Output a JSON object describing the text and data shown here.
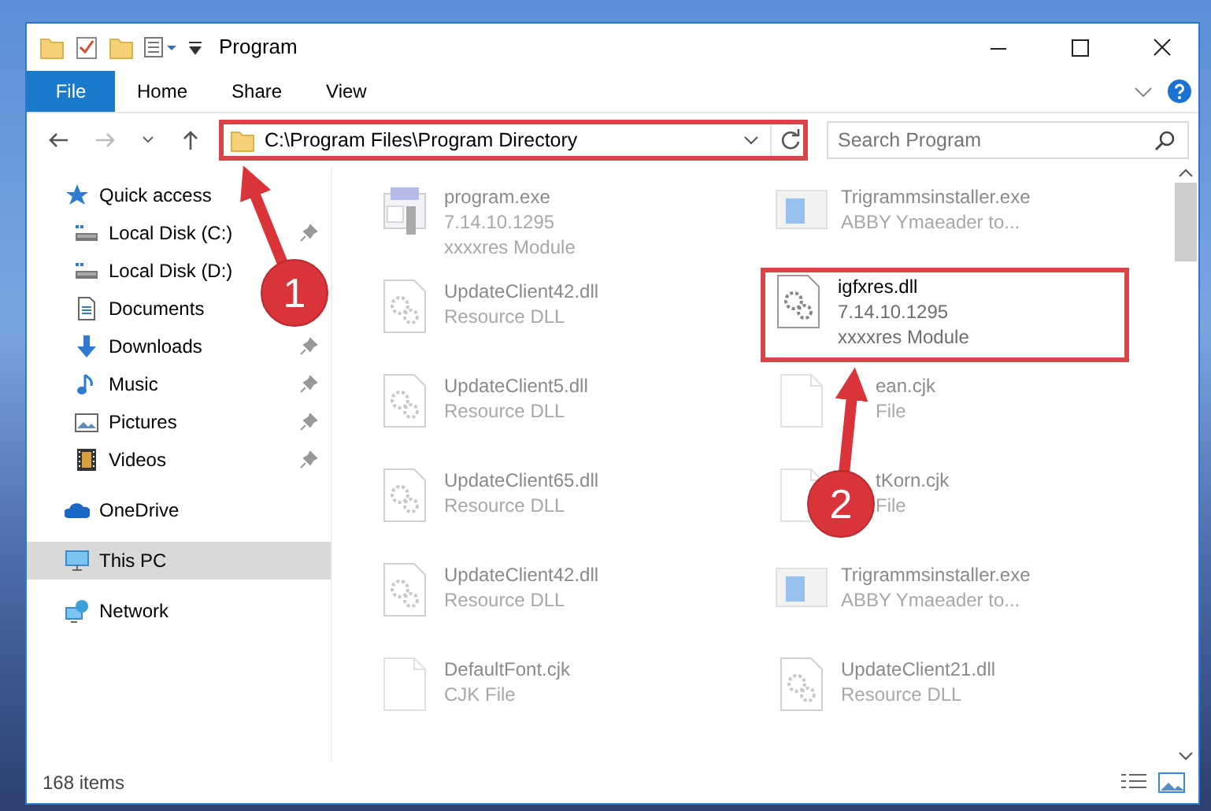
{
  "window": {
    "title": "Program"
  },
  "ribbon_tabs": [
    {
      "label": "File",
      "kind": "file"
    },
    {
      "label": "Home",
      "kind": "tab"
    },
    {
      "label": "Share",
      "kind": "tab"
    },
    {
      "label": "View",
      "kind": "tab"
    }
  ],
  "address": {
    "path": "C:\\Program Files\\Program Directory",
    "highlighted": true
  },
  "search": {
    "placeholder": "Search Program"
  },
  "nav": [
    {
      "label": "Quick access",
      "kind": "star",
      "selected": false,
      "children": [
        {
          "label": "Local Disk (C:)",
          "kind": "drive",
          "pinned": true,
          "selected": false
        },
        {
          "label": "Local Disk (D:)",
          "kind": "drive",
          "pinned": false,
          "selected": false
        },
        {
          "label": "Documents",
          "kind": "doc",
          "pinned": false,
          "selected": false
        },
        {
          "label": "Downloads",
          "kind": "download",
          "pinned": true,
          "selected": false
        },
        {
          "label": "Music",
          "kind": "music",
          "pinned": true,
          "selected": false
        },
        {
          "label": "Pictures",
          "kind": "picture",
          "pinned": true,
          "selected": false
        },
        {
          "label": "Videos",
          "kind": "video",
          "pinned": true,
          "selected": false
        }
      ]
    },
    {
      "label": "OneDrive",
      "kind": "cloud",
      "selected": false
    },
    {
      "label": "This PC",
      "kind": "pc",
      "selected": true
    },
    {
      "label": "Network",
      "kind": "network",
      "selected": false
    }
  ],
  "files": [
    {
      "name": "program.exe",
      "details": [
        "7.14.10.1295",
        "xxxxres Module"
      ],
      "kind": "exe",
      "highlighted": false
    },
    {
      "name": "Trigrammsinstaller.exe",
      "details": [
        "ABBY Ymaeader to..."
      ],
      "kind": "app",
      "highlighted": false
    },
    {
      "name": "UpdateClient42.dll",
      "details": [
        "Resource DLL"
      ],
      "kind": "dll",
      "highlighted": false
    },
    {
      "name": "igfxres.dll",
      "details": [
        "7.14.10.1295",
        "xxxxres Module"
      ],
      "kind": "dll",
      "highlighted": true
    },
    {
      "name": "UpdateClient5.dll",
      "details": [
        "Resource DLL"
      ],
      "kind": "dll",
      "highlighted": false
    },
    {
      "name": "ean.cjk",
      "details": [
        "File"
      ],
      "kind": "blank",
      "highlighted": false
    },
    {
      "name": "UpdateClient65.dll",
      "details": [
        "Resource DLL"
      ],
      "kind": "dll",
      "highlighted": false
    },
    {
      "name": "tKorn.cjk",
      "details": [
        "File"
      ],
      "kind": "blank",
      "highlighted": false
    },
    {
      "name": "UpdateClient42.dll",
      "details": [
        "Resource DLL"
      ],
      "kind": "dll",
      "highlighted": false
    },
    {
      "name": "Trigrammsinstaller.exe",
      "details": [
        "ABBY Ymaeader to..."
      ],
      "kind": "app",
      "highlighted": false
    },
    {
      "name": "DefaultFont.cjk",
      "details": [
        "CJK File"
      ],
      "kind": "blank",
      "highlighted": false
    },
    {
      "name": "UpdateClient21.dll",
      "details": [
        "Resource DLL"
      ],
      "kind": "dll",
      "highlighted": false
    }
  ],
  "callouts": [
    {
      "number": "1"
    },
    {
      "number": "2"
    }
  ],
  "status_bar": {
    "count": "168 items"
  }
}
